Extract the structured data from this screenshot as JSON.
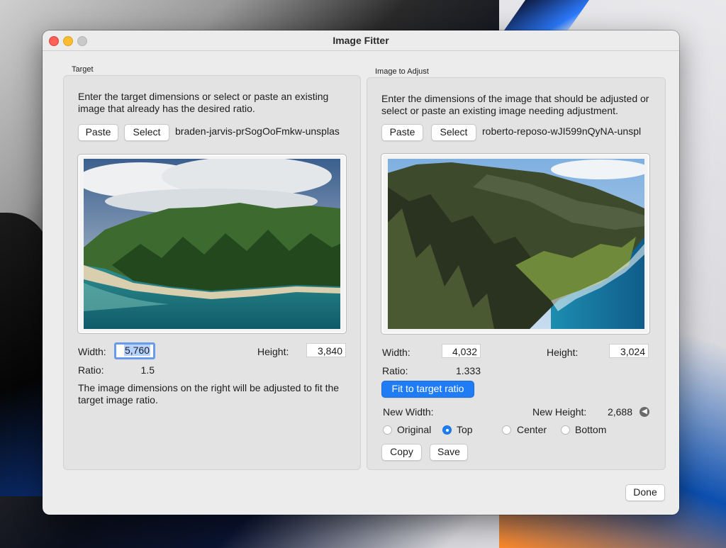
{
  "window": {
    "title": "Image Fitter"
  },
  "target": {
    "group_label": "Target",
    "description": "Enter the target dimensions or select or paste an existing image that already has the desired ratio.",
    "paste_label": "Paste",
    "select_label": "Select",
    "filename": "braden-jarvis-prSogOoFmkw-unsplas",
    "width_label": "Width:",
    "width_value": "5,760",
    "height_label": "Height:",
    "height_value": "3,840",
    "ratio_label": "Ratio:",
    "ratio_value": "1.5",
    "note": "The image dimensions on the right will be adjusted to fit the target image ratio."
  },
  "adjust": {
    "group_label": "Image to Adjust",
    "description": "Enter the dimensions of the image that should be adjusted or select or paste an existing image needing adjustment.",
    "paste_label": "Paste",
    "select_label": "Select",
    "filename": "roberto-reposo-wJI599nQyNA-unspl",
    "width_label": "Width:",
    "width_value": "4,032",
    "height_label": "Height:",
    "height_value": "3,024",
    "ratio_label": "Ratio:",
    "ratio_value": "1.333",
    "fit_label": "Fit to target ratio",
    "new_width_label": "New Width:",
    "new_height_label": "New Height:",
    "new_height_value": "2,688",
    "anchor_options": [
      {
        "label": "Original",
        "selected": false
      },
      {
        "label": "Top",
        "selected": true
      },
      {
        "label": "Center",
        "selected": false
      },
      {
        "label": "Bottom",
        "selected": false
      }
    ],
    "copy_label": "Copy",
    "save_label": "Save"
  },
  "done_label": "Done",
  "icons": {
    "arrow": "arrow-left-circle-icon"
  },
  "colors": {
    "accent": "#1f7cf5",
    "close": "#fe5f57",
    "minimize": "#febc2e"
  }
}
